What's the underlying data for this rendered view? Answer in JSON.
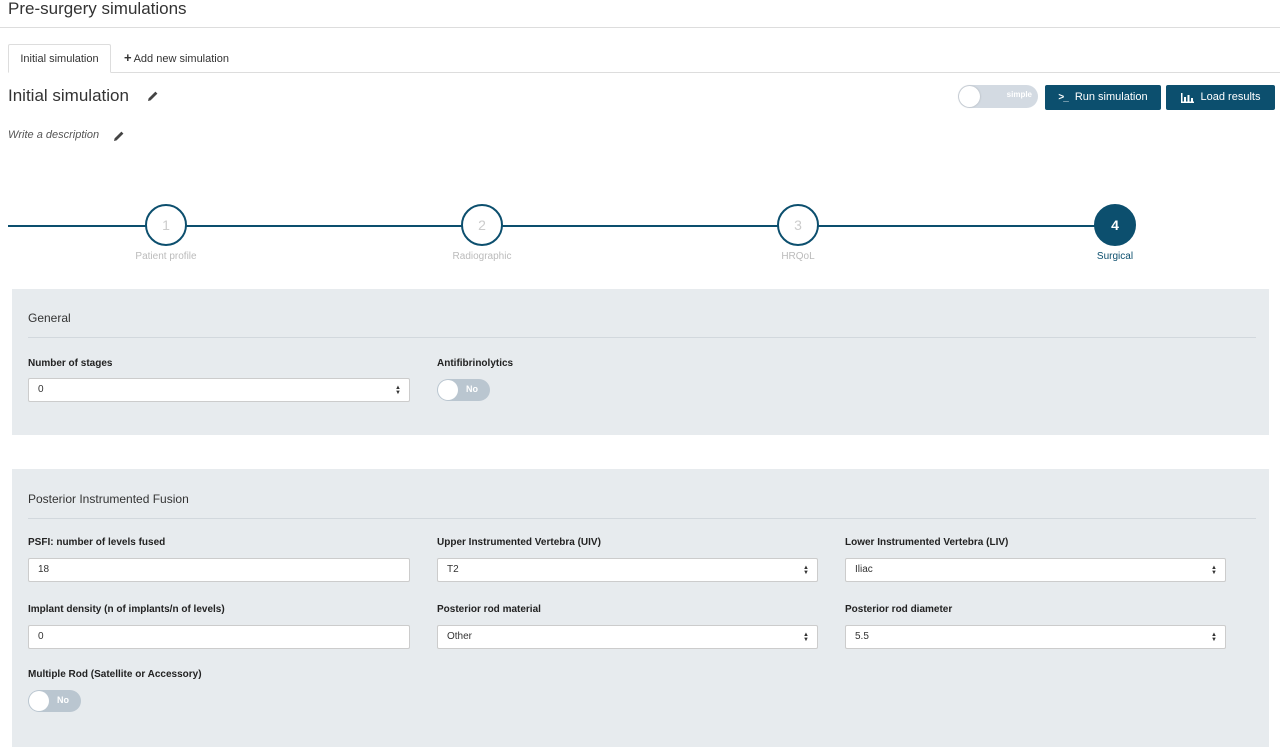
{
  "page": {
    "title": "Pre-surgery simulations"
  },
  "tabs": {
    "active_label": "Initial simulation",
    "add_label": "Add new simulation",
    "add_symbol": "+"
  },
  "simulation": {
    "title": "Initial simulation",
    "description_placeholder": "Write a description"
  },
  "toolbar": {
    "mode_toggle_label": "simple",
    "run_icon": ">_",
    "run_label": "Run simulation",
    "load_label": "Load results"
  },
  "steps": [
    {
      "number": "1",
      "label": "Patient profile"
    },
    {
      "number": "2",
      "label": "Radiographic"
    },
    {
      "number": "3",
      "label": "HRQoL"
    },
    {
      "number": "4",
      "label": "Surgical"
    }
  ],
  "active_step": 4,
  "general": {
    "title": "General",
    "stages_label": "Number of stages",
    "stages_value": "0",
    "antifib_label": "Antifibrinolytics",
    "antifib_value": "No"
  },
  "psf": {
    "title": "Posterior Instrumented Fusion",
    "levels_label": "PSFI: number of levels fused",
    "levels_value": "18",
    "uiv_label": "Upper Instrumented Vertebra (UIV)",
    "uiv_value": "T2",
    "liv_label": "Lower Instrumented Vertebra (LIV)",
    "liv_value": "Iliac",
    "density_label": "Implant density (n of implants/n of levels)",
    "density_value": "0",
    "rod_material_label": "Posterior rod material",
    "rod_material_value": "Other",
    "rod_diameter_label": "Posterior rod diameter",
    "rod_diameter_value": "5.5",
    "multiple_rod_label": "Multiple Rod (Satellite or Accessory)",
    "multiple_rod_value": "No"
  },
  "colors": {
    "primary": "#0c4f6e",
    "panel": "#e7ebee",
    "toggle_off": "#bac6d0"
  }
}
